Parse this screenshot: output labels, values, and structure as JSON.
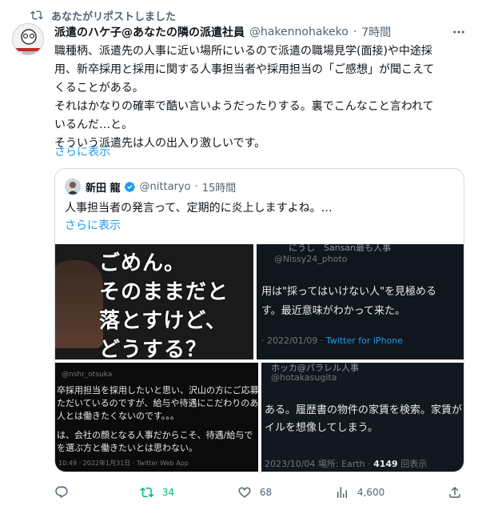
{
  "repost_label": "あなたがリポストしました",
  "tweet": {
    "display_name": "派遣のハケ子@あなたの隣の派遣社員",
    "handle": "@hakennohakeko",
    "separator": "·",
    "time": "7時間",
    "text_lines": [
      "職種柄、派遣先の人事に近い場所にいるので派遣の職場見学(面接)や中途採",
      "用、新卒採用と採用に関する人事担当者や採用担当の「ご感想」が聞こえて",
      "くることがある。",
      "それはかなりの確率で酷い言いようだったりする。裏でこんなこと言われて",
      "いるんだ…と。",
      "そういう派遣先は人の出入り激しいです。"
    ],
    "show_more": "さらに表示"
  },
  "quote": {
    "display_name": "新田 龍",
    "handle": "@nittaryo",
    "separator": "·",
    "time": "15時間",
    "text": "人事担当者の発言って、定期的に炎上しますよね。…",
    "show_more": "さらに表示",
    "media": {
      "image1_lines": [
        "ごめん。",
        "そのままだと",
        "落とすけど、",
        "どうする？"
      ],
      "image2": {
        "top_fragment": "にうし　Sansan最も人事",
        "handle": "@Nissy24_photo",
        "line1": "用は\"採ってはいけない人\"を見極める",
        "line2": "す。最近意味がわかって来た。",
        "footer_date": "· 2022/01/09 ·",
        "footer_app": "Twitter for iPhone"
      },
      "image3": {
        "handle": "@nshr_otsuka",
        "line1": "卒採用担当を採用したいと思い、沢山の方にご応募",
        "line2": "ただいているのですが、給与や待遇にこだわりのあ",
        "line3": "人とは働きたくないのです。。。",
        "line4": "は、会社の顔となる人事だからこそ、待遇/給与で",
        "line5": "を選ぶ方と働きたいとは思わない。",
        "footer": "10:49 · 2022年1月31日 · Twitter Web App"
      },
      "image4": {
        "name_fragment": "ホッカ@パラレル人事",
        "handle": "@hotakasugita",
        "line1": "ある。履歴書の物件の家賃を検索。家賃が",
        "line2": "イルを想像してしまう。",
        "footer_prefix": "2023/10/04 場所: Earth ·",
        "views_count": "4149",
        "views_label": "回表示"
      }
    }
  },
  "actions": {
    "replies": "",
    "reposts": "34",
    "likes": "68",
    "views": "4,600"
  },
  "colors": {
    "accent": "#1d9bf0",
    "repost_green": "#00ba7c",
    "secondary_text": "#536471"
  }
}
